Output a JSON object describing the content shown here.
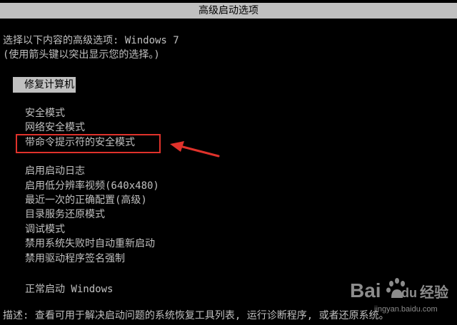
{
  "window": {
    "title": "高级启动选项"
  },
  "prompt": {
    "line1": "选择以下内容的高级选项: Windows 7",
    "line2": "(使用箭头键以突出显示您的选择。)"
  },
  "selected_option": {
    "label": "修复计算机"
  },
  "menu": {
    "items": [
      {
        "label": "安全模式"
      },
      {
        "label": "网络安全模式"
      },
      {
        "label": "带命令提示符的安全模式"
      },
      {
        "label": "启用启动日志"
      },
      {
        "label": "启用低分辨率视频(640x480)"
      },
      {
        "label": "最近一次的正确配置(高级)"
      },
      {
        "label": "目录服务还原模式"
      },
      {
        "label": "调试模式"
      },
      {
        "label": "禁用系统失败时自动重新启动"
      },
      {
        "label": "禁用驱动程序签名强制"
      }
    ],
    "normal_start": "正常启动 Windows"
  },
  "annotation": {
    "highlight_color": "#e0322b",
    "arrow_icon": "red-arrow-icon"
  },
  "footer": {
    "description": "描述: 查看可用于解决启动问题的系统恢复工具列表, 运行诊断程序, 或者还原系统。"
  },
  "watermark": {
    "brand": "Bai",
    "brand_suffix": "du",
    "product": "经验",
    "url": "jingyan.baidu.com"
  },
  "colors": {
    "background": "#000000",
    "text": "#c0c0c0",
    "selection_bg": "#c0c0c0",
    "selection_text": "#000000"
  }
}
